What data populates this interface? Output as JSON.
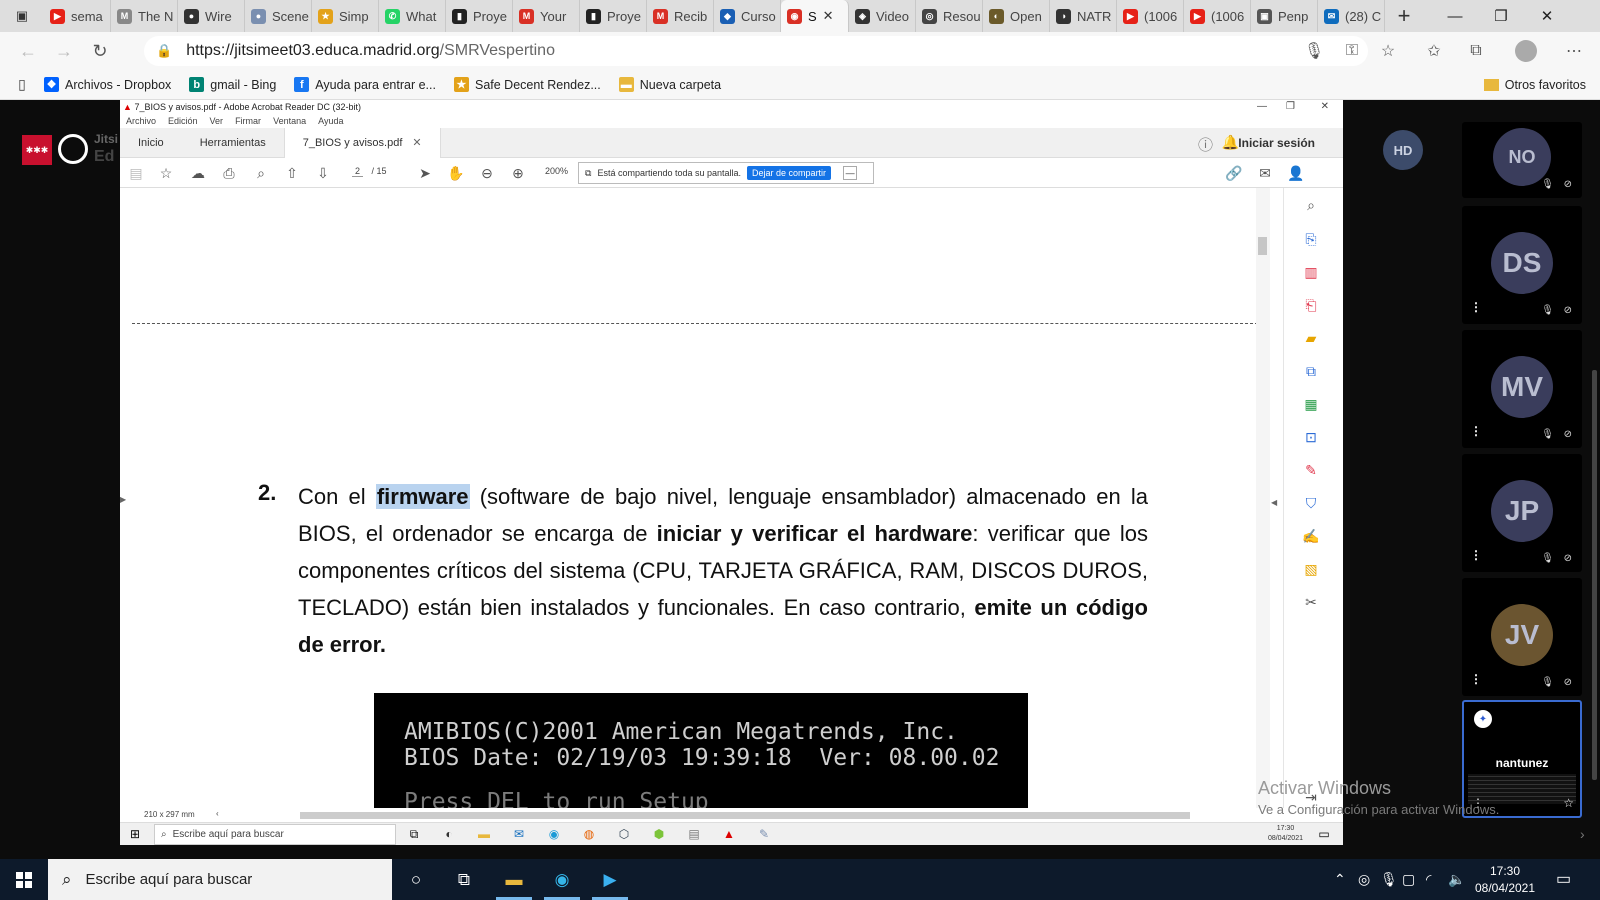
{
  "browser": {
    "tabs": [
      {
        "label": "sema",
        "color": "#e62117",
        "glyph": "▶"
      },
      {
        "label": "The N",
        "color": "#888888",
        "glyph": "M"
      },
      {
        "label": "Wire",
        "color": "#333333",
        "glyph": "●"
      },
      {
        "label": "Scene",
        "color": "#7a8fb0",
        "glyph": "●"
      },
      {
        "label": "Simp",
        "color": "#e3a21a",
        "glyph": "★"
      },
      {
        "label": "What",
        "color": "#25d366",
        "glyph": "✆"
      },
      {
        "label": "Proye",
        "color": "#222222",
        "glyph": "▮"
      },
      {
        "label": "Your",
        "color": "#d93025",
        "glyph": "M"
      },
      {
        "label": "Proye",
        "color": "#222222",
        "glyph": "▮"
      },
      {
        "label": "Recib",
        "color": "#d93025",
        "glyph": "M"
      },
      {
        "label": "Curso",
        "color": "#1a5fb4",
        "glyph": "◆"
      },
      {
        "label": "S",
        "color": "#d93025",
        "glyph": "◉",
        "active": true
      },
      {
        "label": "Video",
        "color": "#333333",
        "glyph": "◈"
      },
      {
        "label": "Resou",
        "color": "#444444",
        "glyph": "◎"
      },
      {
        "label": "Open",
        "color": "#6b5a2a",
        "glyph": "◐"
      },
      {
        "label": "NATR",
        "color": "#333333",
        "glyph": "◑"
      },
      {
        "label": "(1006",
        "color": "#e62117",
        "glyph": "▶"
      },
      {
        "label": "(1006",
        "color": "#e62117",
        "glyph": "▶"
      },
      {
        "label": "Penp",
        "color": "#555555",
        "glyph": "▣"
      },
      {
        "label": "(28) C",
        "color": "#0f6cbd",
        "glyph": "✉"
      }
    ],
    "url_host": "https://jitsimeet03.educa.madrid.org",
    "url_path": "/SMRVespertino",
    "bookmarks": [
      {
        "label": "Archivos - Dropbox",
        "color": "#0061fe",
        "glyph": "❖"
      },
      {
        "label": "gmail - Bing",
        "color": "#008373",
        "glyph": "b"
      },
      {
        "label": "Ayuda para entrar e...",
        "color": "#1877f2",
        "glyph": "f"
      },
      {
        "label": "Safe Decent Rendez...",
        "color": "#e3a21a",
        "glyph": "★"
      },
      {
        "label": "Nueva carpeta",
        "color": "#e8b83d",
        "glyph": "▬"
      }
    ],
    "other_favorites": "Otros favoritos"
  },
  "jitsi": {
    "logo_text": "Jitsi",
    "logo_text2": "Ed",
    "host_avatar": "HD",
    "participants": [
      {
        "initials": "NO",
        "color": "#3a3d5c"
      },
      {
        "initials": "DS",
        "color": "#3a3d5c"
      },
      {
        "initials": "MV",
        "color": "#3a3d5c"
      },
      {
        "initials": "JP",
        "color": "#3a3d5c"
      },
      {
        "initials": "JV",
        "color": "#6b5530"
      }
    ],
    "self_name": "nantunez",
    "watermark_title": "Activar Windows",
    "watermark_sub": "Ve a Configuración para activar Windows."
  },
  "acrobat": {
    "title": "7_BIOS y avisos.pdf - Adobe Acrobat Reader DC (32-bit)",
    "menu": [
      "Archivo",
      "Edición",
      "Ver",
      "Firmar",
      "Ventana",
      "Ayuda"
    ],
    "tabs": [
      "Inicio",
      "Herramientas",
      "7_BIOS y avisos.pdf"
    ],
    "login": "Iniciar sesión",
    "page_current": "2",
    "page_total": "/ 15",
    "zoom": "200%",
    "share_text": "Está compartiendo toda su pantalla.",
    "share_stop": "Dejar de compartir",
    "page_size": "210 x 297 mm",
    "item_number": "2.",
    "para": {
      "t1": "Con el ",
      "hl": "firmware",
      "t2": " (software de bajo nivel, lenguaje ensamblador) almacenado en la BIOS, el ordenador se encarga de ",
      "b1": "iniciar y verificar el hardware",
      "t3": ": verificar que los componentes críticos del sistema (CPU, TARJETA GRÁFICA, RAM, DISCOS DUROS, TECLADO) están bien instalados y funcionales. En caso contrario, ",
      "b2": "emite un código de error."
    },
    "bios_line1": "AMIBIOS(C)2001 American Megatrends, Inc.",
    "bios_line2": "BIOS Date: 02/19/03 19:39:18  Ver: 08.00.02",
    "bios_line3": "Press DEL to run Setup",
    "inner_search": "Escribe aquí para buscar",
    "inner_time": "17:30",
    "inner_date": "08/04/2021"
  },
  "taskbar": {
    "search_placeholder": "Escribe aquí para buscar",
    "time": "17:30",
    "date": "08/04/2021"
  }
}
